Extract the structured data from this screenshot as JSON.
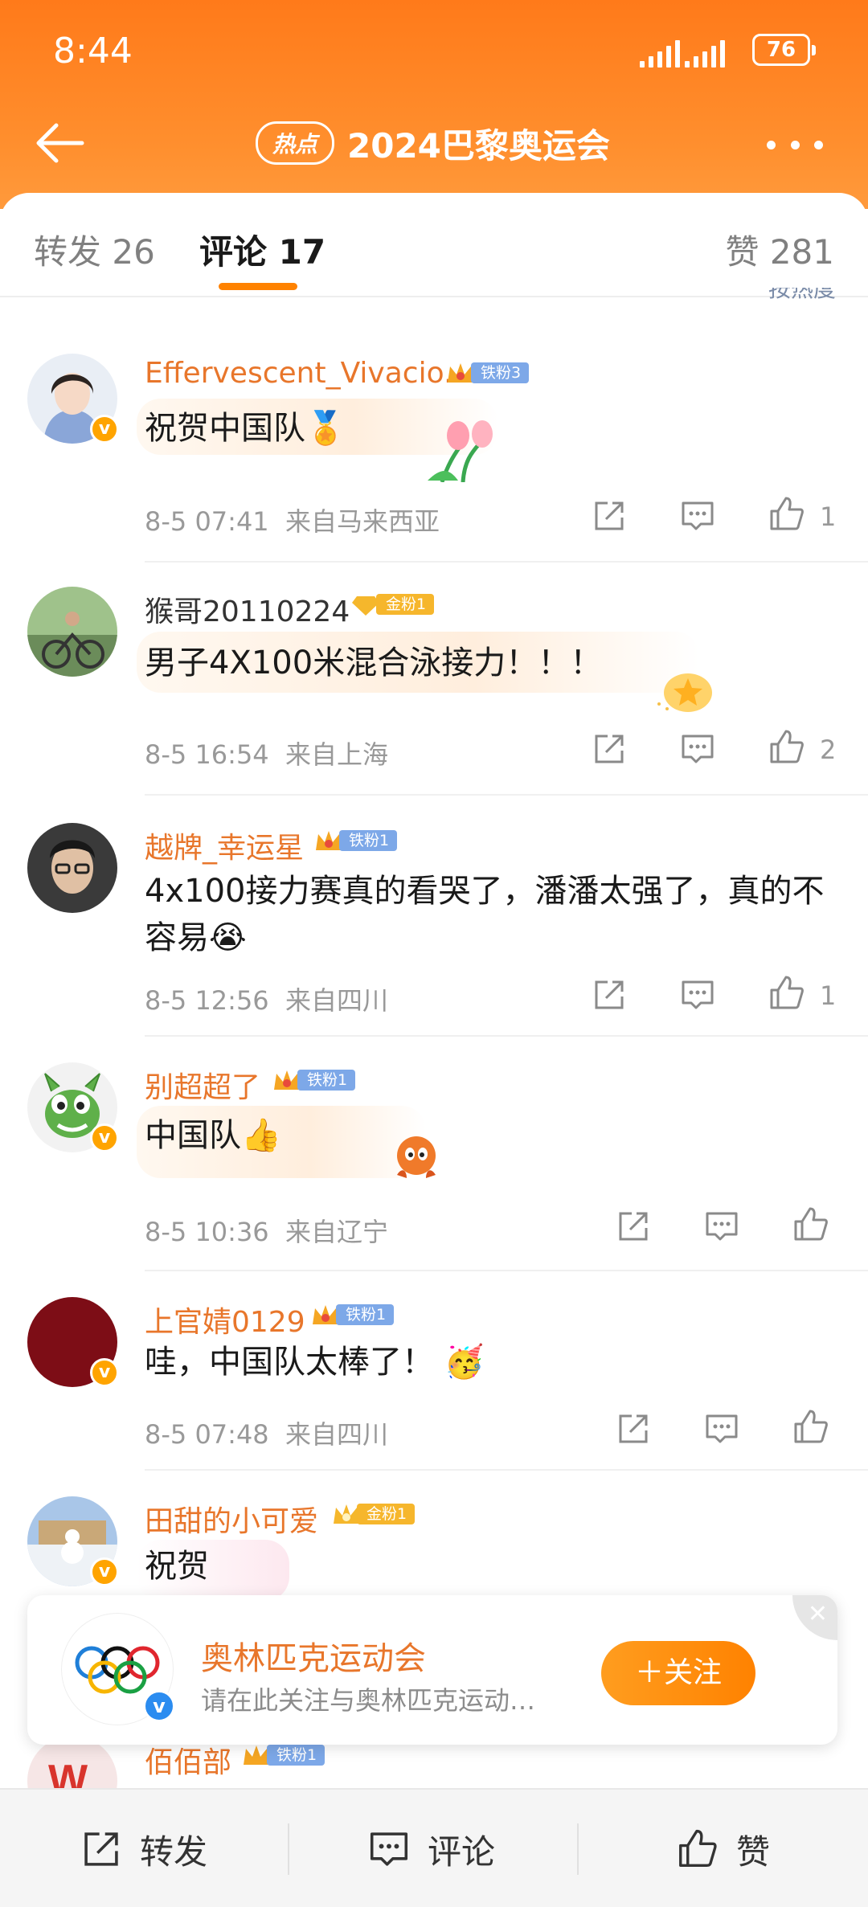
{
  "status_bar": {
    "time": "8:44",
    "battery": "76"
  },
  "header": {
    "hot_badge": "热点",
    "title": "2024巴黎奥运会"
  },
  "tabs": [
    {
      "label": "转发 26"
    },
    {
      "label": "评论 17"
    },
    {
      "label": "赞 281"
    }
  ],
  "sort_hint": "按热度",
  "comments": [
    {
      "username": "Effervescent_Vivacio...",
      "fan_badge": "铁粉3",
      "text": "祝贺中国队🏅",
      "time": "8-5 07:41",
      "location": "来自马来西亚",
      "likes": "1"
    },
    {
      "username": "猴哥20110224",
      "fan_badge": "金粉1",
      "text": "男子4X100米混合泳接力！！！",
      "time": "8-5 16:54",
      "location": "来自上海",
      "likes": "2"
    },
    {
      "username": "越牌_幸运星",
      "fan_badge": "铁粉1",
      "text": "4x100接力赛真的看哭了，潘潘太强了，真的不容易😭",
      "time": "8-5 12:56",
      "location": "来自四川",
      "likes": "1"
    },
    {
      "username": "别超超了",
      "fan_badge": "铁粉1",
      "text": "中国队👍",
      "time": "8-5 10:36",
      "location": "来自辽宁",
      "likes": ""
    },
    {
      "username": "上官婧0129",
      "fan_badge": "铁粉1",
      "text": "哇，中国队太棒了！ 🥳",
      "time": "8-5 07:48",
      "location": "来自四川",
      "likes": ""
    },
    {
      "username": "田甜的小可爱",
      "fan_badge": "金粉1",
      "text": "祝贺",
      "time": "",
      "location": "",
      "likes": ""
    },
    {
      "username": "佰佰部",
      "fan_badge": "铁粉1",
      "text": "",
      "time": "",
      "location": "",
      "likes": ""
    }
  ],
  "follow_card": {
    "name": "奥林匹克运动会",
    "desc": "请在此关注与奥林匹克运动…",
    "button": "＋关注"
  },
  "bottom_bar": {
    "repost": "转发",
    "comment": "评论",
    "like": "赞"
  },
  "colors": {
    "brand_orange": "#ff8200",
    "username_orange": "#e8762b",
    "meta_gray": "#999999"
  }
}
